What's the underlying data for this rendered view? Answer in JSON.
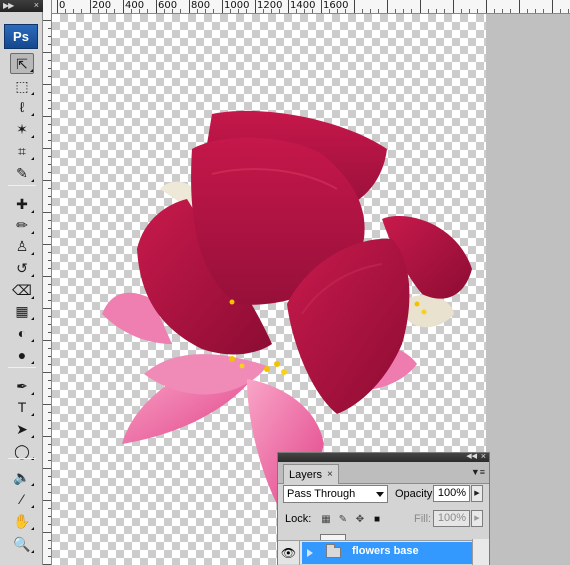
{
  "app": {
    "logo": "Ps"
  },
  "tools": [
    {
      "name": "move-tool",
      "glyph": "⇱"
    },
    {
      "name": "marquee-tool",
      "glyph": "⬚"
    },
    {
      "name": "lasso-tool",
      "glyph": "ℓ"
    },
    {
      "name": "magic-wand-tool",
      "glyph": "✶"
    },
    {
      "name": "crop-tool",
      "glyph": "⌗"
    },
    {
      "name": "eyedropper-tool",
      "glyph": "✎"
    },
    {
      "name": "healing-brush-tool",
      "glyph": "✚"
    },
    {
      "name": "brush-tool",
      "glyph": "✏"
    },
    {
      "name": "clone-stamp-tool",
      "glyph": "♙"
    },
    {
      "name": "history-brush-tool",
      "glyph": "↺"
    },
    {
      "name": "eraser-tool",
      "glyph": "⌫"
    },
    {
      "name": "gradient-tool",
      "glyph": "▦"
    },
    {
      "name": "blur-tool",
      "glyph": "◐"
    },
    {
      "name": "dodge-tool",
      "glyph": "●"
    },
    {
      "name": "pen-tool",
      "glyph": "✒"
    },
    {
      "name": "type-tool",
      "glyph": "T"
    },
    {
      "name": "path-selection-tool",
      "glyph": "➤"
    },
    {
      "name": "ellipse-tool",
      "glyph": "◯"
    },
    {
      "name": "notes-tool",
      "glyph": "🔈"
    },
    {
      "name": "sample-eyedropper-tool",
      "glyph": "⁄"
    },
    {
      "name": "hand-tool",
      "glyph": "✋"
    },
    {
      "name": "zoom-tool",
      "glyph": "🔍"
    }
  ],
  "ruler": {
    "labels": [
      "0",
      "200",
      "400",
      "600",
      "800",
      "1000",
      "1200",
      "1400",
      "1600"
    ]
  },
  "layers_panel": {
    "tab_label": "Layers",
    "close_glyph": "×",
    "blend_mode": "Pass Through",
    "opacity_label": "Opacity:",
    "opacity_value": "100%",
    "lock_label": "Lock:",
    "fill_label": "Fill:",
    "fill_value": "100%",
    "layers": [
      {
        "name": "flowers base",
        "visible": true,
        "selected": true
      }
    ]
  },
  "colors": {
    "accent": "#3399ff",
    "flower_deep": "#a8123c",
    "flower_pink": "#e85b97"
  }
}
